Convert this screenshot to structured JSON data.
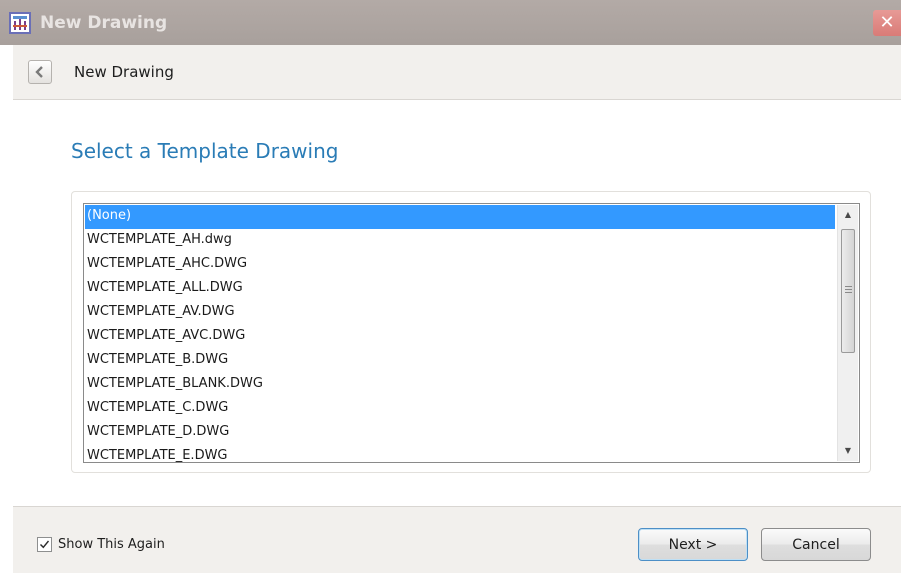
{
  "window": {
    "title": "New Drawing",
    "close_glyph": "✕"
  },
  "nav": {
    "title": "New Drawing",
    "back_icon": "chevron-left-icon"
  },
  "main": {
    "heading": "Select a Template Drawing",
    "templates": [
      "(None)",
      "WCTEMPLATE_AH.dwg",
      "WCTEMPLATE_AHC.DWG",
      "WCTEMPLATE_ALL.DWG",
      "WCTEMPLATE_AV.DWG",
      "WCTEMPLATE_AVC.DWG",
      "WCTEMPLATE_B.DWG",
      "WCTEMPLATE_BLANK.DWG",
      "WCTEMPLATE_C.DWG",
      "WCTEMPLATE_D.DWG",
      "WCTEMPLATE_E.DWG"
    ],
    "selected_index": 0,
    "scroll_up_glyph": "▲",
    "scroll_down_glyph": "▼"
  },
  "footer": {
    "show_again_label": "Show This Again",
    "show_again_checked": true,
    "next_label": "Next >",
    "cancel_label": "Cancel"
  },
  "colors": {
    "selection": "#3399ff",
    "heading": "#2a7cb6",
    "close_button": "#d97b77"
  }
}
